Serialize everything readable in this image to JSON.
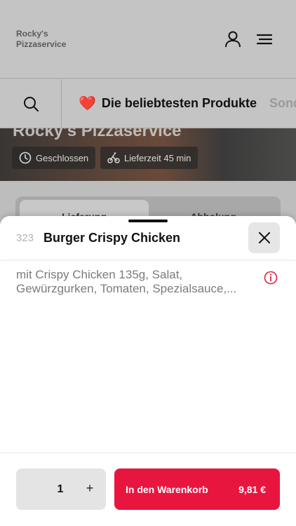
{
  "header": {
    "brand_line1": "Rocky's",
    "brand_line2": "Pizzaservice",
    "icons": [
      "user-icon",
      "menu-icon"
    ]
  },
  "categories": {
    "active_emoji": "❤️",
    "active_label": "Die beliebtesten Produkte",
    "next_label": "Sond"
  },
  "restaurant": {
    "title": "Rocky's Pizzaservice",
    "status": "Geschlossen",
    "delivery_time": "Lieferzeit 45 min"
  },
  "order_tabs": {
    "delivery": "Lieferung",
    "pickup": "Abholung"
  },
  "product": {
    "number": "323",
    "name": "Burger Crispy Chicken",
    "description_line1": "mit Crispy Chicken 135g, Salat,",
    "description_line2": "Gewürzgurken, Tomaten, Spezialsauce,..."
  },
  "footer": {
    "quantity": "1",
    "plus": "+",
    "add_to_cart": "In den Warenkorb",
    "price": "9,81 €"
  },
  "colors": {
    "accent": "#e8163f",
    "info": "#d9243f"
  }
}
